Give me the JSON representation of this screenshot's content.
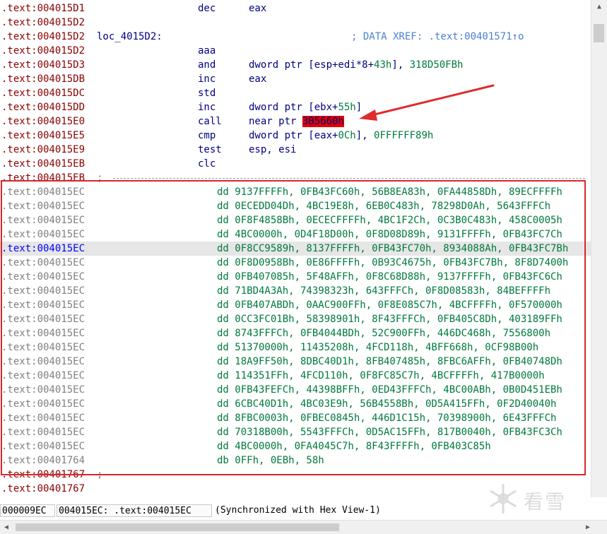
{
  "lines": [
    {
      "kind": "code",
      "addr": ".text:004015D1",
      "mnem": "dec",
      "ops": [
        {
          "t": "eax",
          "c": "reg"
        }
      ]
    },
    {
      "kind": "code",
      "addr": ".text:004015D2"
    },
    {
      "kind": "code",
      "addr": ".text:004015D2",
      "label": "loc_4015D2:",
      "comment": "; DATA XREF: .text:00401571↑o"
    },
    {
      "kind": "code",
      "addr": ".text:004015D2",
      "mnem": "aaa"
    },
    {
      "kind": "code",
      "addr": ".text:004015D3",
      "mnem": "and",
      "ops": [
        {
          "t": "dword ptr [esp+edi*8+",
          "c": "reg"
        },
        {
          "t": "43h",
          "c": "num"
        },
        {
          "t": "], ",
          "c": "reg"
        },
        {
          "t": "318D50FBh",
          "c": "num"
        }
      ]
    },
    {
      "kind": "code",
      "addr": ".text:004015DB",
      "mnem": "inc",
      "ops": [
        {
          "t": "eax",
          "c": "reg"
        }
      ]
    },
    {
      "kind": "code",
      "addr": ".text:004015DC",
      "mnem": "std"
    },
    {
      "kind": "code",
      "addr": ".text:004015DD",
      "mnem": "inc",
      "ops": [
        {
          "t": "dword ptr [ebx+",
          "c": "reg"
        },
        {
          "t": "55h",
          "c": "num"
        },
        {
          "t": "]",
          "c": "reg"
        }
      ]
    },
    {
      "kind": "code",
      "addr": ".text:004015E0",
      "mnem": "call",
      "ops": [
        {
          "t": "near ptr ",
          "c": "reg"
        },
        {
          "t": "3B5660h",
          "c": "hl"
        }
      ]
    },
    {
      "kind": "code",
      "addr": ".text:004015E5",
      "mnem": "cmp",
      "ops": [
        {
          "t": "dword ptr [eax+",
          "c": "reg"
        },
        {
          "t": "0Ch",
          "c": "num"
        },
        {
          "t": "], ",
          "c": "reg"
        },
        {
          "t": "0FFFFFF89h",
          "c": "num"
        }
      ]
    },
    {
      "kind": "code",
      "addr": ".text:004015E9",
      "mnem": "test",
      "ops": [
        {
          "t": "esp, esi",
          "c": "reg"
        }
      ]
    },
    {
      "kind": "code",
      "addr": ".text:004015EB",
      "mnem": "clc"
    },
    {
      "kind": "sep",
      "addr": ".text:004015EB",
      "sep": ";"
    },
    {
      "kind": "data",
      "addr": ".text:004015EC",
      "text": "dd 9137FFFFh, 0FB43FC60h, 56B8EA83h, 0FA44858Dh, 89ECFFFFh"
    },
    {
      "kind": "data",
      "addr": ".text:004015EC",
      "text": "dd 0ECEDD04Dh, 4BC19E8h, 6EB0C483h, 78298D0Ah, 5643FFFCh"
    },
    {
      "kind": "data",
      "addr": ".text:004015EC",
      "text": "dd 0F8F4858Bh, 0ECECFFFFh, 4BC1F2Ch, 0C3B0C483h, 458C0005h"
    },
    {
      "kind": "data",
      "addr": ".text:004015EC",
      "text": "dd 4BC0000h, 0D4F18D00h, 0F8D08D89h, 9131FFFFh, 0FB43FC7Ch"
    },
    {
      "kind": "data",
      "addr": ".text:004015EC",
      "text": "dd 0F8CC9589h, 8137FFFFh, 0FB43FC70h, 8934088Ah, 0FB43FC7Bh",
      "selected": true
    },
    {
      "kind": "data",
      "addr": ".text:004015EC",
      "text": "dd 0F8D0958Bh, 0E86FFFFh, 0B93C4675h, 0FB43FC7Bh, 8F8D7400h"
    },
    {
      "kind": "data",
      "addr": ".text:004015EC",
      "text": "dd 0FB407085h, 5F48AFFh, 0F8C68D88h, 9137FFFFh, 0FB43FC6Ch"
    },
    {
      "kind": "data",
      "addr": ".text:004015EC",
      "text": "dd 71BD4A3Ah, 74398323h, 643FFFCh, 0F8D08583h, 84BEFFFFh"
    },
    {
      "kind": "data",
      "addr": ".text:004015EC",
      "text": "dd 0FB407ABDh, 0AAC900FFh, 0F8E085C7h, 4BCFFFFh, 0F570000h"
    },
    {
      "kind": "data",
      "addr": ".text:004015EC",
      "text": "dd 0CC3FC01Bh, 58398901h, 8F43FFFCh, 0FB405C8Dh, 403189FFh"
    },
    {
      "kind": "data",
      "addr": ".text:004015EC",
      "text": "dd 8743FFFCh, 0FB4044BDh, 52C900FFh, 446DC468h, 7556800h"
    },
    {
      "kind": "data",
      "addr": ".text:004015EC",
      "text": "dd 51370000h, 11435208h, 4FCD118h, 4BFF668h, 0CF98B00h"
    },
    {
      "kind": "data",
      "addr": ".text:004015EC",
      "text": "dd 18A9FF50h, 8DBC40D1h, 8FB407485h, 8FBC6AFFh, 0FB40748Dh"
    },
    {
      "kind": "data",
      "addr": ".text:004015EC",
      "text": "dd 114351FFh, 4FCD110h, 0F8FC85C7h, 4BCFFFFh, 417B0000h"
    },
    {
      "kind": "data",
      "addr": ".text:004015EC",
      "text": "dd 0FB43FEFCh, 44398BFFh, 0ED43FFFCh, 4BC00ABh, 0B0D451EBh"
    },
    {
      "kind": "data",
      "addr": ".text:004015EC",
      "text": "dd 6CBC40D1h, 4BC03E9h, 56B4558Bh, 0D5A415FFh, 0F2D40040h"
    },
    {
      "kind": "data",
      "addr": ".text:004015EC",
      "text": "dd 8FBC0003h, 0FBEC0845h, 446D1C15h, 70398900h, 6E43FFFCh"
    },
    {
      "kind": "data",
      "addr": ".text:004015EC",
      "text": "dd 70318B00h, 5543FFFCh, 0D5AC15FFh, 817B0040h, 0FB43FC3Ch"
    },
    {
      "kind": "data",
      "addr": ".text:004015EC",
      "text": "dd 4BC0000h, 0FA4045C7h, 8F43FFFFh, 0FB403C85h"
    },
    {
      "kind": "data",
      "addr": ".text:00401764",
      "text": "db 0FFh, 0EBh, 58h"
    },
    {
      "kind": "sep",
      "addr": ".text:00401767",
      "sep": ";"
    },
    {
      "kind": "code",
      "addr": ".text:00401767"
    }
  ],
  "status": {
    "file_offset": "000009EC",
    "location": "004015EC: .text:004015EC",
    "message": "(Synchronized with Hex View-1)"
  },
  "watermark": {
    "text": "看雪"
  },
  "colors": {
    "highlight": "#e00000",
    "annotation": "#d9262a",
    "address_code": "#8b0000",
    "address_data": "#808080",
    "address_selected": "#0000ff",
    "number": "#007a3d",
    "mnemonic": "#000080"
  }
}
